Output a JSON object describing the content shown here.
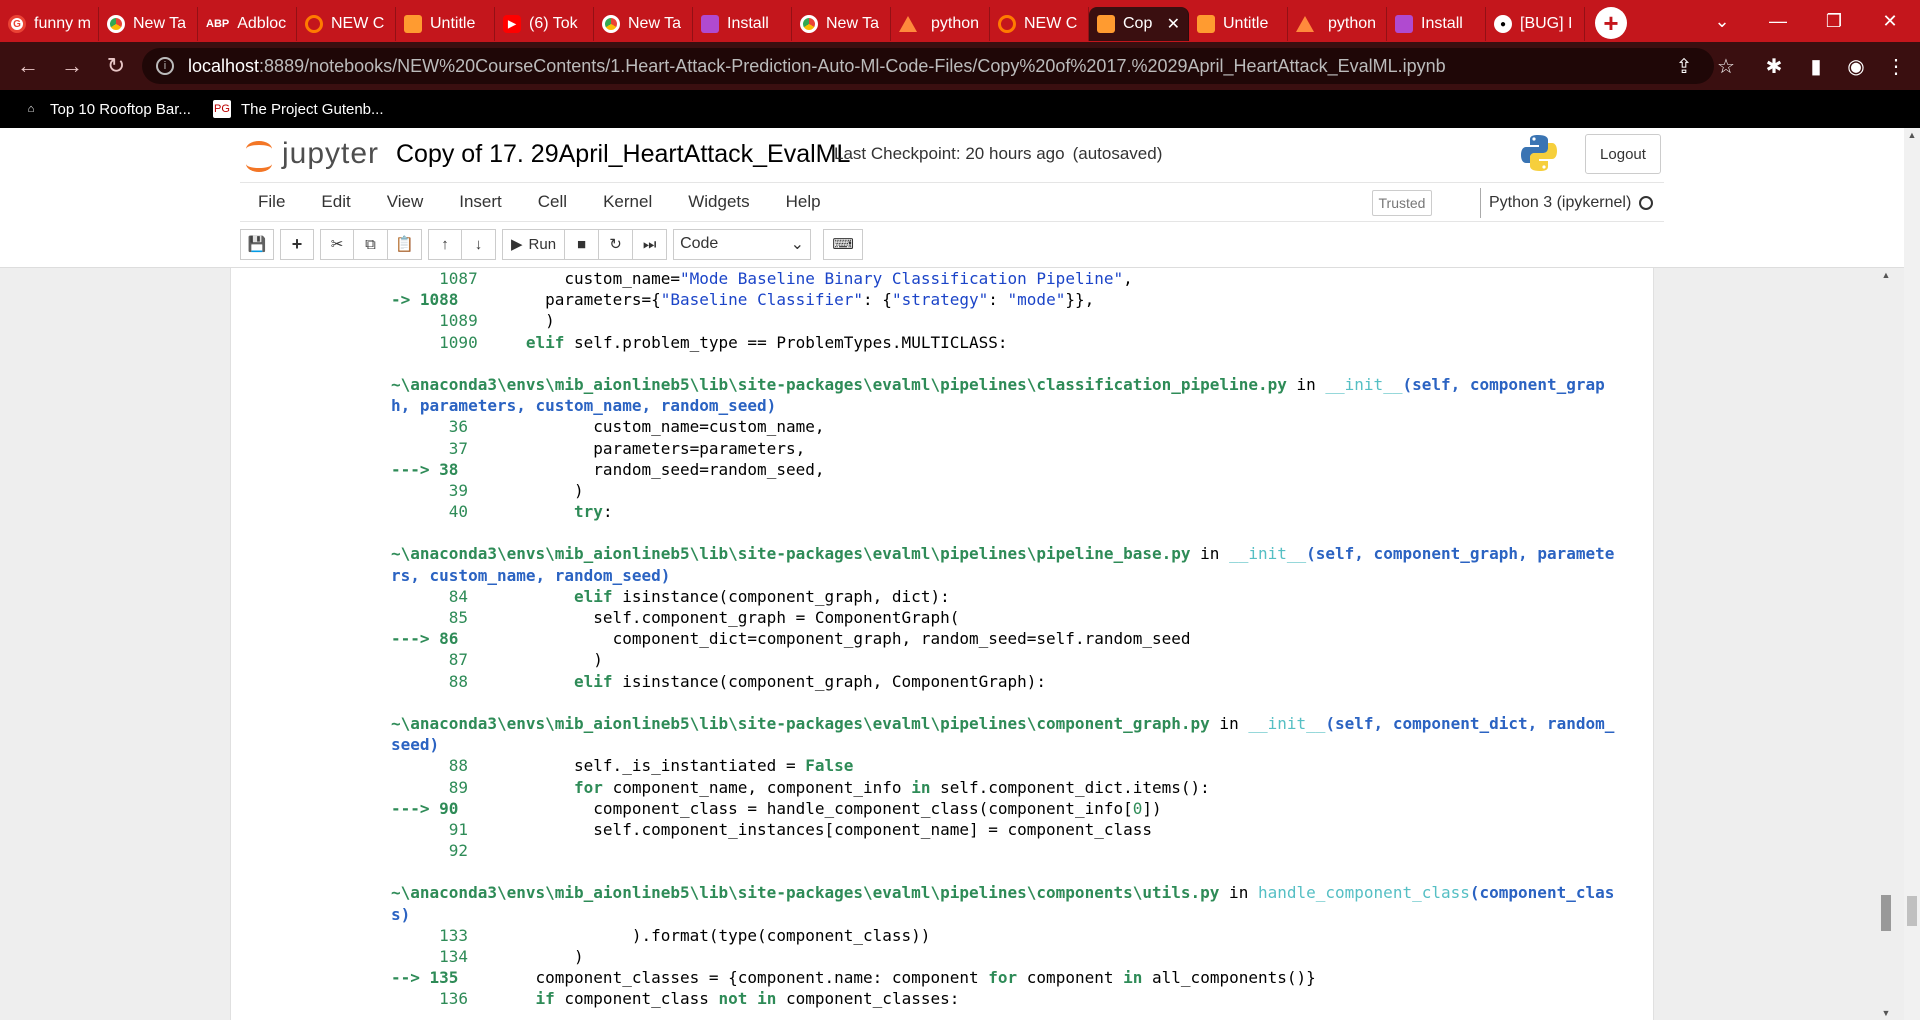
{
  "browser": {
    "tabs": [
      {
        "title": "funny m",
        "icon": "google-icon"
      },
      {
        "title": "New Ta",
        "icon": "chrome-icon"
      },
      {
        "title": "Adbloc",
        "icon": "adblock-icon"
      },
      {
        "title": "NEW C",
        "icon": "ring-icon"
      },
      {
        "title": "Untitle",
        "icon": "jupyter-doc-icon"
      },
      {
        "title": "(6) Tok",
        "icon": "youtube-icon"
      },
      {
        "title": "New Ta",
        "icon": "chrome-icon"
      },
      {
        "title": "Install",
        "icon": "pg-icon"
      },
      {
        "title": "New Ta",
        "icon": "chrome-icon"
      },
      {
        "title": "python",
        "icon": "triangle-icon"
      },
      {
        "title": "NEW C",
        "icon": "ring-icon"
      },
      {
        "title": "Cop",
        "icon": "jupyter-doc-icon",
        "active": true
      },
      {
        "title": "Untitle",
        "icon": "jupyter-doc-icon"
      },
      {
        "title": "python",
        "icon": "triangle-icon"
      },
      {
        "title": "Install",
        "icon": "pg-icon"
      },
      {
        "title": "[BUG] I",
        "icon": "github-icon"
      }
    ],
    "address": {
      "host": "localhost",
      "rest": ":8889/notebooks/NEW%20CourseContents/1.Heart-Attack-Prediction-Auto-Ml-Code-Files/Copy%20of%2017.%2029April_HeartAttack_EvalML.ipynb"
    },
    "bookmarks": [
      {
        "label": "Top 10 Rooftop Bar...",
        "icon": "globe-icon"
      },
      {
        "label": "The Project Gutenb...",
        "icon": "pg-icon"
      }
    ],
    "colors": {
      "tabbar": "#c4161c",
      "toolbar": "#3a0f10",
      "bookmarks": "#000000"
    }
  },
  "jupyter": {
    "logo_text": "jupyter",
    "notebook_title": "Copy of 17. 29April_HeartAttack_EvalML",
    "checkpoint": "Last Checkpoint: 20 hours ago",
    "autosave": "(autosaved)",
    "logout": "Logout",
    "menu": [
      "File",
      "Edit",
      "View",
      "Insert",
      "Cell",
      "Kernel",
      "Widgets",
      "Help"
    ],
    "trusted": "Trusted",
    "kernel": "Python 3 (ipykernel)",
    "run_label": "Run",
    "cell_type": "Code"
  },
  "traceback": {
    "block1": [
      {
        "num": "1087",
        "code": "custom_name=\"Mode Baseline Binary Classification Pipeline\","
      },
      {
        "num": "1088",
        "code": "parameters={\"Baseline Classifier\": {\"strategy\": \"mode\"}},"
      },
      {
        "num": "1089",
        "code": ")"
      },
      {
        "num": "1090",
        "code": "elif self.problem_type == ProblemTypes.MULTICLASS:"
      }
    ],
    "frames": [
      {
        "path": "~\\anaconda3\\envs\\mib_aionlineb5\\lib\\site-packages\\evalml\\pipelines\\classification_pipeline.py",
        "func": "__init__",
        "args_line1": "(self, component_grap",
        "args_line2": "h, parameters, custom_name, random_seed)",
        "lines": [
          {
            "num": "36",
            "code": "custom_name=custom_name,"
          },
          {
            "num": "37",
            "code": "parameters=parameters,"
          },
          {
            "num": "38",
            "code": "random_seed=random_seed,"
          },
          {
            "num": "39",
            "code": ")"
          },
          {
            "num": "40",
            "code": "try:"
          }
        ]
      },
      {
        "path": "~\\anaconda3\\envs\\mib_aionlineb5\\lib\\site-packages\\evalml\\pipelines\\pipeline_base.py",
        "func": "__init__",
        "args_line1": "(self, component_graph, paramete",
        "args_line2": "rs, custom_name, random_seed)",
        "lines": [
          {
            "num": "84",
            "code": "elif isinstance(component_graph, dict):"
          },
          {
            "num": "85",
            "code": "self.component_graph = ComponentGraph("
          },
          {
            "num": "86",
            "code": "component_dict=component_graph, random_seed=self.random_seed"
          },
          {
            "num": "87",
            "code": ")"
          },
          {
            "num": "88",
            "code": "elif isinstance(component_graph, ComponentGraph):"
          }
        ]
      },
      {
        "path": "~\\anaconda3\\envs\\mib_aionlineb5\\lib\\site-packages\\evalml\\pipelines\\component_graph.py",
        "func": "__init__",
        "args_line1": "(self, component_dict, random_",
        "args_line2": "seed)",
        "lines": [
          {
            "num": "88",
            "code": "self._is_instantiated = False"
          },
          {
            "num": "89",
            "code": "for component_name, component_info in self.component_dict.items():"
          },
          {
            "num": "90",
            "code": "component_class = handle_component_class(component_info[0])"
          },
          {
            "num": "91",
            "code": "self.component_instances[component_name] = component_class"
          },
          {
            "num": "92",
            "code": ""
          }
        ]
      },
      {
        "path": "~\\anaconda3\\envs\\mib_aionlineb5\\lib\\site-packages\\evalml\\pipelines\\components\\utils.py",
        "func": "handle_component_class",
        "args_line1": "(component_clas",
        "args_line2": "s)",
        "lines": [
          {
            "num": "133",
            "code": ").format(type(component_class))"
          },
          {
            "num": "134",
            "code": ")"
          },
          {
            "num": "135",
            "code": "component_classes = {component.name: component for component in all_components()}"
          },
          {
            "num": "136",
            "code": "if component_class not in component_classes:"
          }
        ]
      }
    ]
  }
}
